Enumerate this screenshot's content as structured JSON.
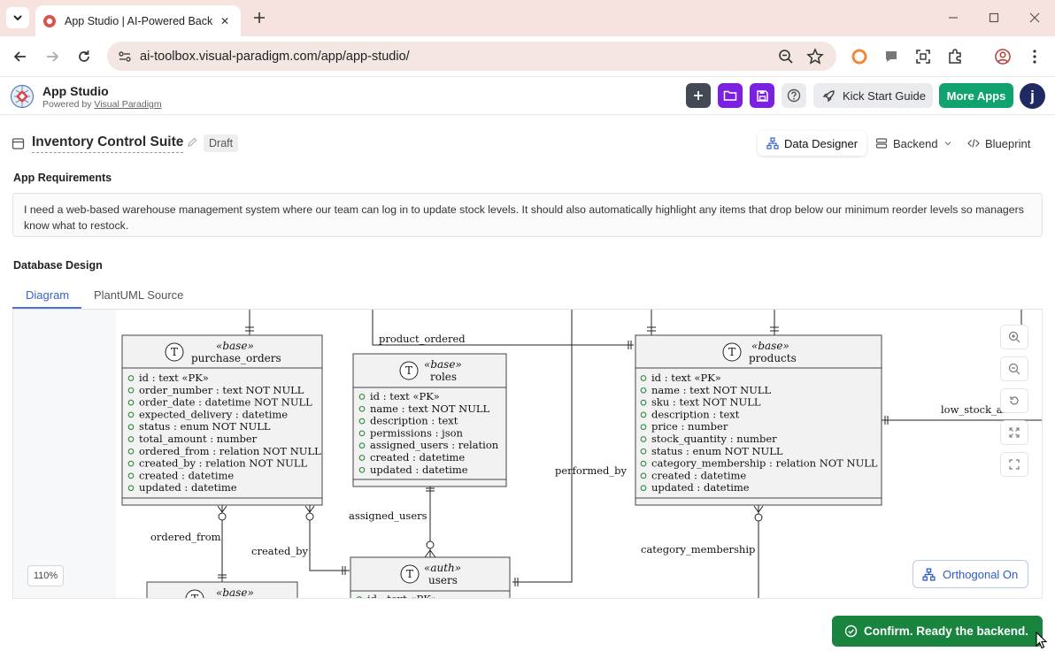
{
  "browser": {
    "tab_title": "App Studio | AI-Powered Backend",
    "url": "ai-toolbox.visual-paradigm.com/app/app-studio/"
  },
  "app": {
    "title": "App Studio",
    "powered_by": "Powered by",
    "powered_by_link": "Visual Paradigm",
    "kick_start": "Kick Start Guide",
    "more_apps": "More Apps",
    "avatar_initial": "j"
  },
  "project": {
    "name": "Inventory Control Suite",
    "status": "Draft",
    "views": [
      "Data Designer",
      "Backend",
      "Blueprint"
    ],
    "active_view": "Data Designer"
  },
  "requirements": {
    "label": "App Requirements",
    "text": "I need a web-based warehouse management system where our team can log in to update stock levels. It should also automatically highlight any items that drop below our minimum reorder levels so managers know what to restock."
  },
  "database": {
    "label": "Database Design",
    "tabs": [
      "Diagram",
      "PlantUML Source"
    ],
    "active_tab": "Diagram",
    "zoom": "110%",
    "orthogonal": "Orthogonal On"
  },
  "erd": {
    "entities": [
      {
        "id": "purchase_orders",
        "stereotype": "«base»",
        "name": "purchase_orders",
        "fields": [
          "id : text «PK»",
          "order_number : text NOT NULL",
          "order_date : datetime NOT NULL",
          "expected_delivery : datetime",
          "status : enum NOT NULL",
          "total_amount : number",
          "ordered_from : relation NOT NULL",
          "created_by : relation NOT NULL",
          "created : datetime",
          "updated : datetime"
        ]
      },
      {
        "id": "roles",
        "stereotype": "«base»",
        "name": "roles",
        "fields": [
          "id : text «PK»",
          "name : text NOT NULL",
          "description : text",
          "permissions : json",
          "assigned_users : relation",
          "created : datetime",
          "updated : datetime"
        ]
      },
      {
        "id": "products",
        "stereotype": "«base»",
        "name": "products",
        "fields": [
          "id : text «PK»",
          "name : text NOT NULL",
          "sku : text NOT NULL",
          "description : text",
          "price : number",
          "stock_quantity : number",
          "status : enum NOT NULL",
          "category_membership : relation NOT NULL",
          "created : datetime",
          "updated : datetime"
        ]
      },
      {
        "id": "users",
        "stereotype": "«auth»",
        "name": "users",
        "fields": [
          "id : text «PK»"
        ]
      },
      {
        "id": "suppliers",
        "stereotype": "«base»",
        "name": "",
        "fields": []
      }
    ],
    "relation_labels": {
      "product_ordered": "product_ordered",
      "performed_by": "performed_by",
      "low_stock_alert": "low_stock_alert",
      "assigned_users": "assigned_users",
      "ordered_from": "ordered_from",
      "created_by": "created_by",
      "category_membership": "category_membership"
    },
    "entity_icon_letter": "T"
  },
  "actions": {
    "confirm": "Confirm. Ready the backend."
  },
  "colors": {
    "accent_green": "#10a36e",
    "confirm_green": "#18843e",
    "purple": "#7b1fe0",
    "link_blue": "#3a62c8"
  }
}
